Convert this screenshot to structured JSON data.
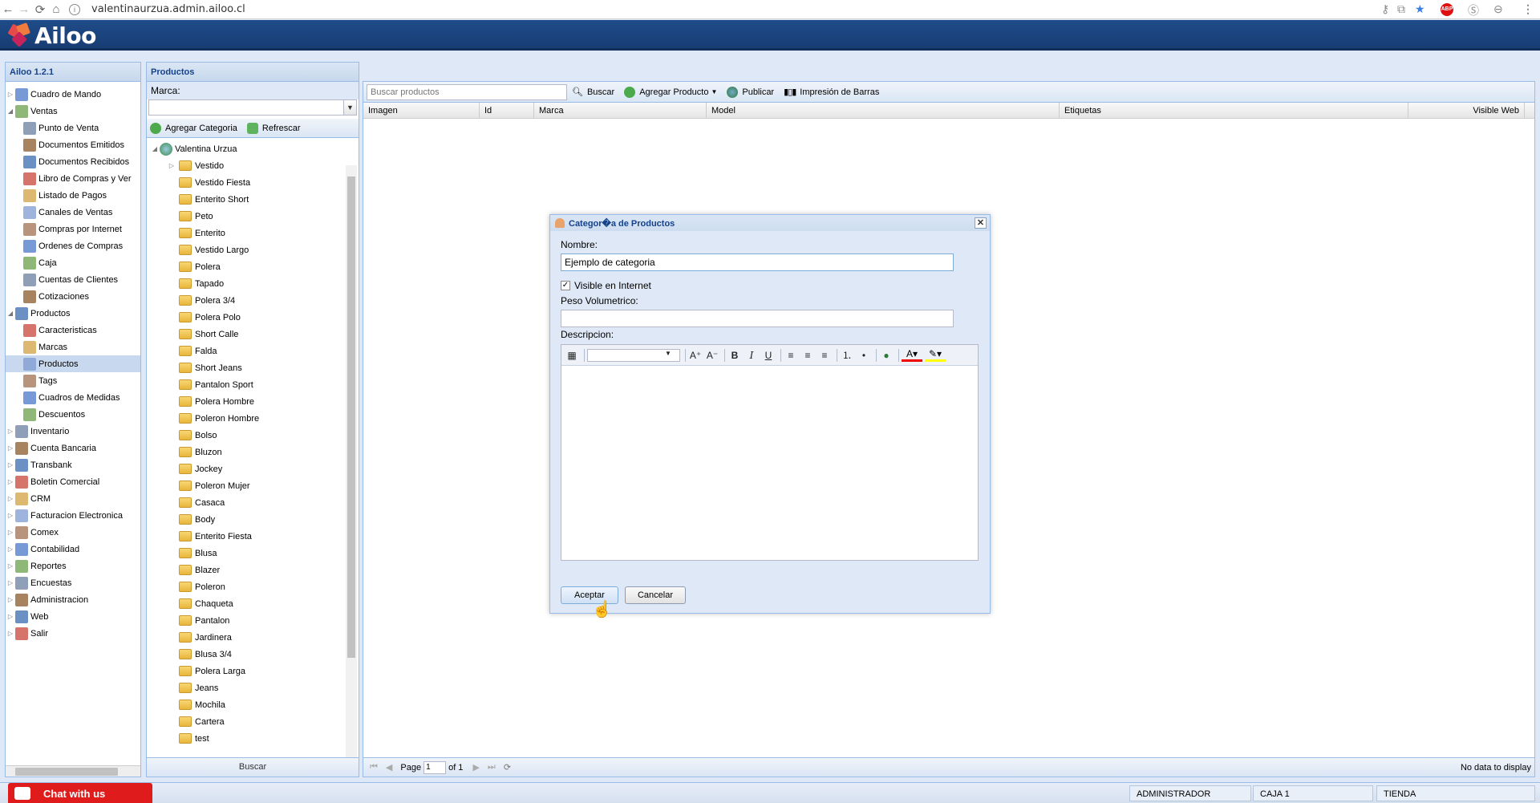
{
  "browser": {
    "url": "valentinaurzua.admin.ailoo.cl"
  },
  "app": {
    "logo_text": "Ailoo",
    "colors": {
      "header": "#1f4c8a",
      "accent": "#15428b",
      "chat": "#e01b1b"
    }
  },
  "sidebar": {
    "title": "Ailoo 1.2.1",
    "items": [
      {
        "label": "Cuadro de Mando",
        "level": 0,
        "icon": "chart-icon"
      },
      {
        "label": "Ventas",
        "level": 0,
        "icon": "sales-icon",
        "expanded": true
      },
      {
        "label": "Punto de Venta",
        "level": 1,
        "icon": "register-icon"
      },
      {
        "label": "Documentos Emitidos",
        "level": 1,
        "icon": "document-icon"
      },
      {
        "label": "Documentos Recibidos",
        "level": 1,
        "icon": "document-icon"
      },
      {
        "label": "Libro de Compras y Ver",
        "level": 1,
        "icon": "book-icon"
      },
      {
        "label": "Listado de Pagos",
        "level": 1,
        "icon": "list-icon"
      },
      {
        "label": "Canales de Ventas",
        "level": 1,
        "icon": "cart-icon"
      },
      {
        "label": "Compras por Internet",
        "level": 1,
        "icon": "cart-icon"
      },
      {
        "label": "Ordenes de Compras",
        "level": 1,
        "icon": "cart-icon"
      },
      {
        "label": "Caja",
        "level": 1,
        "icon": "cashbox-icon"
      },
      {
        "label": "Cuentas de Clientes",
        "level": 1,
        "icon": "accounts-icon"
      },
      {
        "label": "Cotizaciones",
        "level": 1,
        "icon": "quote-icon"
      },
      {
        "label": "Productos",
        "level": 0,
        "icon": "box-icon",
        "expanded": true
      },
      {
        "label": "Caracteristicas",
        "level": 1,
        "icon": "features-icon"
      },
      {
        "label": "Marcas",
        "level": 1,
        "icon": "ribbon-icon"
      },
      {
        "label": "Productos",
        "level": 1,
        "icon": "product-icon",
        "selected": true
      },
      {
        "label": "Tags",
        "level": 1,
        "icon": "tag-icon"
      },
      {
        "label": "Cuadros de Medidas",
        "level": 1,
        "icon": "ruler-icon"
      },
      {
        "label": "Descuentos",
        "level": 1,
        "icon": "discount-icon"
      },
      {
        "label": "Inventario",
        "level": 0,
        "icon": "inventory-icon"
      },
      {
        "label": "Cuenta Bancaria",
        "level": 0,
        "icon": "bank-icon"
      },
      {
        "label": "Transbank",
        "level": 0,
        "icon": "transbank-icon"
      },
      {
        "label": "Boletin Comercial",
        "level": 0,
        "icon": "newsletter-icon"
      },
      {
        "label": "CRM",
        "level": 0,
        "icon": "crm-icon"
      },
      {
        "label": "Facturacion Electronica",
        "level": 0,
        "icon": "invoice-icon"
      },
      {
        "label": "Comex",
        "level": 0,
        "icon": "comex-icon"
      },
      {
        "label": "Contabilidad",
        "level": 0,
        "icon": "ledger-icon"
      },
      {
        "label": "Reportes",
        "level": 0,
        "icon": "report-icon"
      },
      {
        "label": "Encuestas",
        "level": 0,
        "icon": "survey-icon"
      },
      {
        "label": "Administracion",
        "level": 0,
        "icon": "gear-icon"
      },
      {
        "label": "Web",
        "level": 0,
        "icon": "globe-icon"
      },
      {
        "label": "Salir",
        "level": 0,
        "icon": "exit-icon"
      }
    ]
  },
  "products_panel": {
    "title": "Productos",
    "brand_label": "Marca:",
    "add_category": "Agregar Categoria",
    "refresh": "Refrescar",
    "search_button": "Buscar",
    "root": "Valentina Urzua",
    "categories": [
      "Vestido",
      "Vestido Fiesta",
      "Enterito Short",
      "Peto",
      "Enterito",
      "Vestido Largo",
      "Polera",
      "Tapado",
      "Polera 3/4",
      "Polera Polo",
      "Short Calle",
      "Falda",
      "Short Jeans",
      "Pantalon Sport",
      "Polera Hombre",
      "Poleron Hombre",
      "Bolso",
      "Bluzon",
      "Jockey",
      "Poleron Mujer",
      "Casaca",
      "Body",
      "Enterito Fiesta",
      "Blusa",
      "Blazer",
      "Poleron",
      "Chaqueta",
      "Pantalon",
      "Jardinera",
      "Blusa 3/4",
      "Polera Larga",
      "Jeans",
      "Mochila",
      "Cartera",
      "test"
    ]
  },
  "grid": {
    "search_placeholder": "Buscar productos",
    "search": "Buscar",
    "add_product": "Agregar Producto",
    "publish": "Publicar",
    "barcodes": "Impresión de Barras",
    "columns": [
      "Imagen",
      "Id",
      "Marca",
      "Model",
      "Etiquetas",
      "Visible Web"
    ],
    "page_label": "Page",
    "page_value": "1",
    "of_label": "of 1",
    "empty": "No data to display"
  },
  "dialog": {
    "title": "Categor�a de Productos",
    "name_label": "Nombre:",
    "name_value": "Ejemplo de categoria",
    "visible_label": "Visible en Internet",
    "weight_label": "Peso Volumetrico:",
    "weight_value": "",
    "desc_label": "Descripcion:",
    "accept": "Aceptar",
    "cancel": "Cancelar"
  },
  "status": {
    "user": "ADMINISTRADOR",
    "cash": "CAJA 1",
    "store": "TIENDA",
    "chat": "Chat with us"
  }
}
